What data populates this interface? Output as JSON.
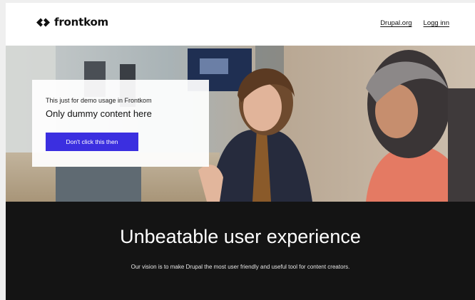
{
  "header": {
    "logo_icon": "frontkom-logo-icon",
    "logo_text": "frontkom",
    "nav": [
      {
        "label": "Drupal.org"
      },
      {
        "label": "Logg inn"
      }
    ]
  },
  "hero": {
    "kicker": "This just for demo usage in Frontkom",
    "heading": "Only dummy content here",
    "button_label": "Don't click this then",
    "button_color": "#3b2fe0"
  },
  "feature": {
    "title": "Unbeatable user experience",
    "text": "Our vision is to make Drupal the most user friendly and useful tool for content creators."
  }
}
